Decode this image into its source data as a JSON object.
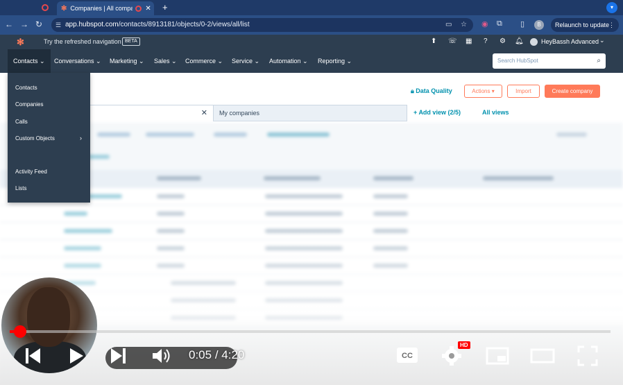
{
  "browser": {
    "active_tab_title": "Companies | All companie",
    "new_tab": "+",
    "url_host": "app.hubspot.com",
    "url_path": "/contacts/8913181/objects/0-2/views/all/list",
    "profile_initial": "B",
    "relaunch_label": "Relaunch to update"
  },
  "hubspot_top": {
    "try_text": "Try the refreshed navigation",
    "beta": "BETA",
    "account_name": "HeyBassh Advanced"
  },
  "nav": {
    "items": [
      "Contacts",
      "Conversations",
      "Marketing",
      "Sales",
      "Commerce",
      "Service",
      "Automation",
      "Reporting"
    ],
    "search_placeholder": "Search HubSpot"
  },
  "dropdown": {
    "items": [
      "Contacts",
      "Companies",
      "Calls",
      "Custom Objects",
      "Activity Feed",
      "Lists"
    ]
  },
  "page": {
    "data_quality": "Data Quality",
    "actions": "Actions ▾",
    "import": "Import",
    "create": "Create company",
    "view_tab_2": "My companies",
    "add_view": "Add view (2/5)",
    "all_views": "All views"
  },
  "video": {
    "current_time": "0:05",
    "duration": "4:20",
    "progress": 0.019,
    "hd_badge": "HD"
  },
  "colors": {
    "hubspot_orange": "#ff7a59",
    "hubspot_nav": "#2d3e50",
    "link_teal": "#0091ae",
    "youtube_red": "#ff0000"
  }
}
